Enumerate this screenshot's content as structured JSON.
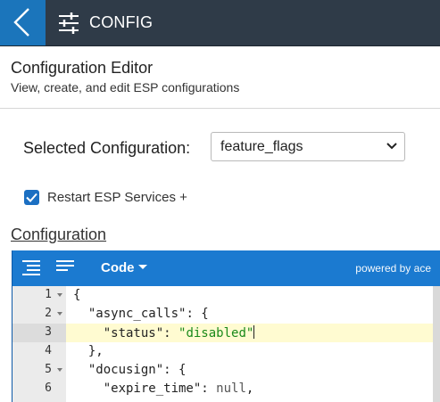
{
  "topbar": {
    "title": "CONFIG",
    "back_icon": "chevron-left-icon",
    "config_icon": "sliders-icon"
  },
  "header": {
    "title": "Configuration Editor",
    "subtitle": "View, create, and edit ESP configurations"
  },
  "selector": {
    "label": "Selected Configuration:",
    "value": "feature_flags"
  },
  "restart": {
    "label": "Restart ESP Services +",
    "checked": true
  },
  "config_link": "Configuration",
  "editor": {
    "mode_label": "Code",
    "powered_by": "powered by ace",
    "colors": {
      "toolbar": "#1b7ad0",
      "string": "#1a8a1a",
      "active_line": "#fffbd1"
    },
    "lines": [
      {
        "num": "1",
        "foldable": true
      },
      {
        "num": "2",
        "foldable": true,
        "key": "\"async_calls\""
      },
      {
        "num": "3",
        "foldable": false,
        "key": "\"status\"",
        "value": "\"disabled\"",
        "active": true
      },
      {
        "num": "4",
        "foldable": false,
        "text": "},"
      },
      {
        "num": "5",
        "foldable": true,
        "key": "\"docusign\""
      },
      {
        "num": "6",
        "foldable": false,
        "key": "\"expire_time\"",
        "value": "null"
      }
    ]
  }
}
